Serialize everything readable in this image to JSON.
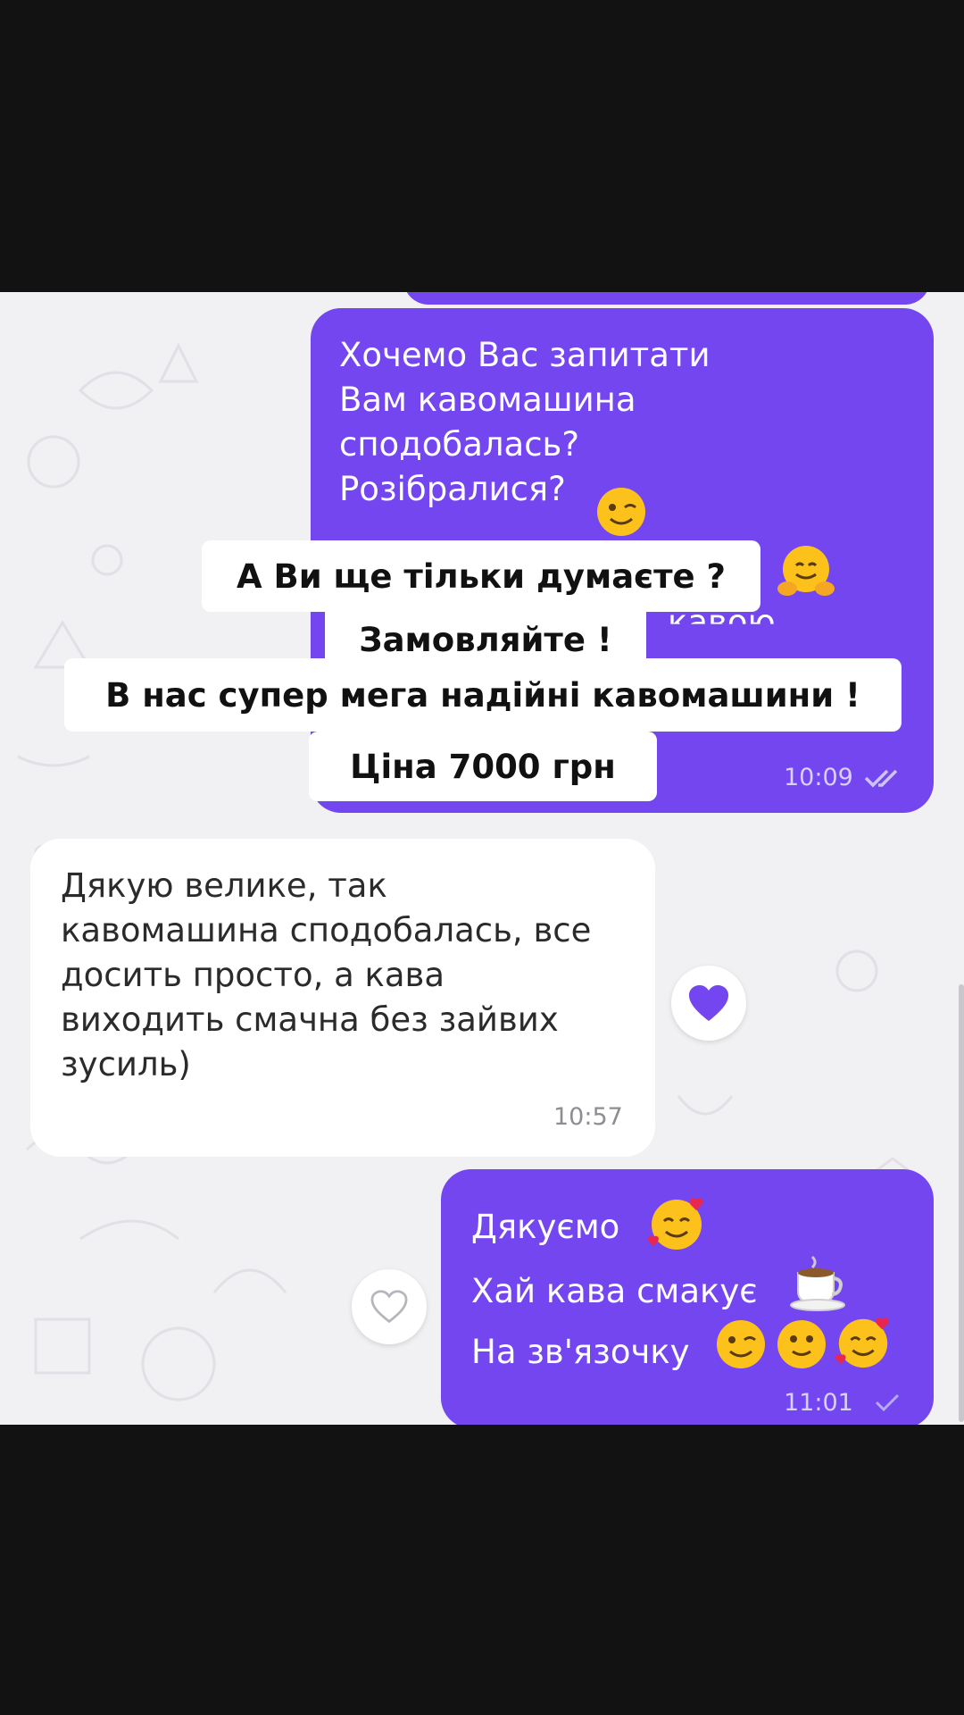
{
  "messages": {
    "first_out": {
      "text": "Хочемо Вас запитати\nВам кавомашина\nсподобалась?\nРозібралися?",
      "hidden_fragment": "кавою",
      "time": "10:09",
      "status": "read"
    },
    "reply_in": {
      "text": "Дякую велике, так\nкавомашина сподобалась, все\nдосить просто, а кава\nвиходить смачна без зайвих\nзусиль)",
      "time": "10:57",
      "reaction": "purple-heart"
    },
    "second_out": {
      "line1": "Дякуємо",
      "line2": "Хай кава смакує",
      "line3": "На зв'язочку",
      "time": "11:01",
      "status": "sent"
    }
  },
  "overlay": {
    "line1": "А Ви ще тільки думаєте ?",
    "line2": "Замовляйте !",
    "line3": "В нас супер мега надійні кавомашини !",
    "line4": "Ціна 7000 грн"
  },
  "colors": {
    "outgoing_bubble": "#7346f0",
    "incoming_bubble": "#ffffff",
    "chat_background": "#f1f0f3",
    "frame": "#121212"
  },
  "icons": [
    "winking-face-icon",
    "hugging-face-icon",
    "smiling-face-hearts-icon",
    "coffee-cup-icon",
    "slightly-smiling-face-icon",
    "double-check-icon",
    "single-check-icon",
    "heart-outline-icon",
    "heart-filled-icon"
  ]
}
